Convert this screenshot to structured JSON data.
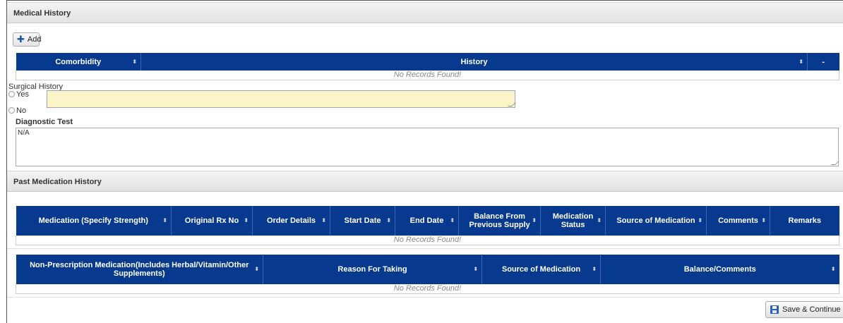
{
  "sections": {
    "medical_history": "Medical History",
    "past_medication_history": "Past Medication History"
  },
  "add_button": {
    "label": "Add",
    "icon": "plus-icon"
  },
  "comorbidity_table": {
    "columns": [
      "Comorbidity",
      "History",
      "-"
    ],
    "empty_text": "No Records Found!"
  },
  "surgical_history": {
    "label": "Surgical History",
    "yes_label": "Yes",
    "no_label": "No",
    "value": ""
  },
  "diagnostic_test": {
    "label": "Diagnostic Test",
    "value": "N/A"
  },
  "medication_table": {
    "columns": [
      "Medication (Specify Strength)",
      "Original Rx No",
      "Order Details",
      "Start Date",
      "End Date",
      "Balance From Previous Supply",
      "Medication Status",
      "Source of Medication",
      "Comments",
      "Remarks"
    ],
    "empty_text": "No Records Found!"
  },
  "non_prescription_table": {
    "columns": [
      "Non-Prescription Medication(Includes Herbal/Vitamin/Other Supplements)",
      "Reason For Taking",
      "Source of Medication",
      "Balance/Comments"
    ],
    "empty_text": "No Records Found!"
  },
  "save_button": {
    "label": "Save & Continue",
    "icon": "save-icon"
  },
  "colors": {
    "header_blue": "#07398e",
    "input_yellow": "#fbf4c6"
  }
}
